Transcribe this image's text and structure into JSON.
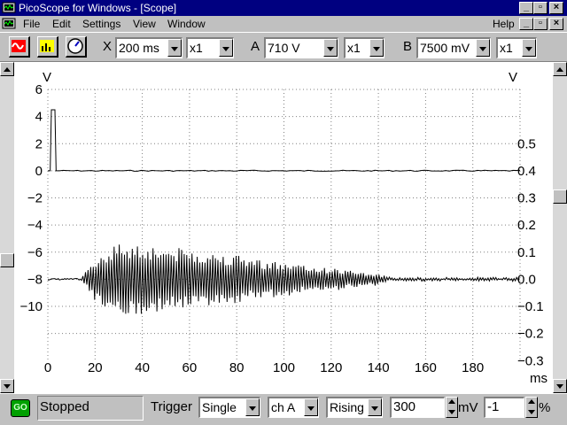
{
  "window": {
    "title": "PicoScope for Windows - [Scope]"
  },
  "menu": {
    "items": [
      {
        "label": "File",
        "accel": "F"
      },
      {
        "label": "Edit",
        "accel": "E"
      },
      {
        "label": "Settings",
        "accel": "S"
      },
      {
        "label": "View",
        "accel": "V"
      },
      {
        "label": "Window",
        "accel": "W"
      }
    ],
    "help": "Help"
  },
  "toolbar": {
    "x_label": "X",
    "x_timebase": "200 ms",
    "x_mult": "x1",
    "a_label": "A",
    "a_range": "710 V",
    "a_mult": "x1",
    "b_label": "B",
    "b_range": "7500 mV",
    "b_mult": "x1"
  },
  "chart_data": {
    "type": "line",
    "xlabel": "ms",
    "ylabel_left": "V",
    "ylabel_right": "V",
    "xlim": [
      0,
      200
    ],
    "ylim_left": [
      -12,
      6
    ],
    "ylim_right": [
      -0.3,
      0.6
    ],
    "x_ticks": [
      0,
      20,
      40,
      60,
      80,
      100,
      120,
      140,
      160,
      180
    ],
    "y_ticks_left": [
      6,
      4,
      2,
      0,
      -2,
      -4,
      -6,
      -8,
      -10
    ],
    "y_ticks_right": [
      0.5,
      0.4,
      0.3,
      0.2,
      0.1,
      0.0,
      -0.1,
      -0.2,
      -0.3
    ],
    "grid": true,
    "series": [
      {
        "channel": "A",
        "axis": "left",
        "color": "#000000",
        "description_points": [
          [
            0,
            0
          ],
          [
            1,
            0
          ],
          [
            1.5,
            4.5
          ],
          [
            3,
            4.5
          ],
          [
            3.5,
            0
          ],
          [
            200,
            0
          ]
        ]
      },
      {
        "channel": "B",
        "axis": "right",
        "color": "#000000",
        "baseline": 0.0,
        "envelope": [
          [
            0,
            0.0
          ],
          [
            14,
            0.0
          ],
          [
            20,
            0.08
          ],
          [
            30,
            0.14
          ],
          [
            40,
            0.13
          ],
          [
            60,
            0.11
          ],
          [
            80,
            0.09
          ],
          [
            100,
            0.06
          ],
          [
            120,
            0.04
          ],
          [
            140,
            0.02
          ],
          [
            145,
            0.005
          ],
          [
            200,
            0.005
          ]
        ]
      }
    ]
  },
  "status": {
    "go_label": "GO",
    "state": "Stopped",
    "trigger_label": "Trigger",
    "trigger_mode": "Single",
    "trigger_channel": "ch A",
    "trigger_edge": "Rising",
    "trigger_level": "300",
    "trigger_unit": "mV",
    "trigger_delay": "-1",
    "trigger_delay_unit": "%"
  },
  "colors": {
    "titlebar": "#000080",
    "face": "#c0c0c0",
    "go_button": "#00a000"
  }
}
